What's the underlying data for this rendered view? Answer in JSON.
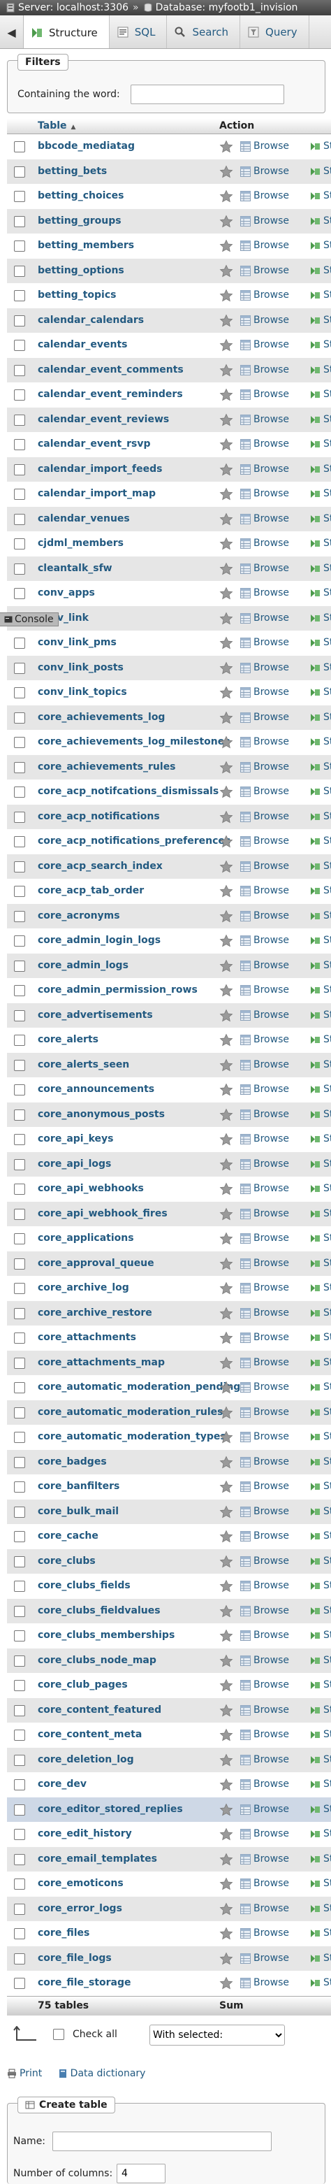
{
  "breadcrumb": {
    "server": "Server: localhost:3306",
    "separator": "»",
    "database": "Database: myfootb1_invision"
  },
  "tabs": [
    {
      "label": "Structure",
      "icon": "structure-icon",
      "active": true
    },
    {
      "label": "SQL",
      "icon": "sql-icon",
      "active": false
    },
    {
      "label": "Search",
      "icon": "search-icon",
      "active": false
    },
    {
      "label": "Query",
      "icon": "query-icon",
      "active": false
    }
  ],
  "filters": {
    "legend": "Filters",
    "label": "Containing the word:",
    "value": ""
  },
  "table": {
    "header_table": "Table",
    "header_action": "Action",
    "sort_indicator": "▲",
    "browse_label": "Browse",
    "structure_label": "Str",
    "rows": [
      "bbcode_mediatag",
      "betting_bets",
      "betting_choices",
      "betting_groups",
      "betting_members",
      "betting_options",
      "betting_topics",
      "calendar_calendars",
      "calendar_events",
      "calendar_event_comments",
      "calendar_event_reminders",
      "calendar_event_reviews",
      "calendar_event_rsvp",
      "calendar_import_feeds",
      "calendar_import_map",
      "calendar_venues",
      "cjdml_members",
      "cleantalk_sfw",
      "conv_apps",
      "conv_link",
      "conv_link_pms",
      "conv_link_posts",
      "conv_link_topics",
      "core_achievements_log",
      "core_achievements_log_milestones",
      "core_achievements_rules",
      "core_acp_notifcations_dismissals",
      "core_acp_notifications",
      "core_acp_notifications_preferences",
      "core_acp_search_index",
      "core_acp_tab_order",
      "core_acronyms",
      "core_admin_login_logs",
      "core_admin_logs",
      "core_admin_permission_rows",
      "core_advertisements",
      "core_alerts",
      "core_alerts_seen",
      "core_announcements",
      "core_anonymous_posts",
      "core_api_keys",
      "core_api_logs",
      "core_api_webhooks",
      "core_api_webhook_fires",
      "core_applications",
      "core_approval_queue",
      "core_archive_log",
      "core_archive_restore",
      "core_attachments",
      "core_attachments_map",
      "core_automatic_moderation_pending",
      "core_automatic_moderation_rules",
      "core_automatic_moderation_types",
      "core_badges",
      "core_banfilters",
      "core_bulk_mail",
      "core_cache",
      "core_clubs",
      "core_clubs_fields",
      "core_clubs_fieldvalues",
      "core_clubs_memberships",
      "core_clubs_node_map",
      "core_club_pages",
      "core_content_featured",
      "core_content_meta",
      "core_deletion_log",
      "core_dev",
      "core_editor_stored_replies",
      "core_edit_history",
      "core_email_templates",
      "core_emoticons",
      "core_error_logs",
      "core_files",
      "core_file_logs",
      "core_file_storage"
    ],
    "footer_count": "75 tables",
    "footer_sum": "Sum"
  },
  "console": {
    "label": "Console"
  },
  "bulk": {
    "check_all_label": "Check all",
    "with_selected": "With selected:"
  },
  "links": {
    "print": "Print",
    "data_dictionary": "Data dictionary"
  },
  "create_table": {
    "legend": "Create table",
    "name_label": "Name:",
    "name_value": "",
    "columns_label": "Number of columns:",
    "columns_value": "4"
  },
  "colors": {
    "link": "#235a81",
    "row_even": "#e6e6e6",
    "row_highlight": "#ced8e6",
    "topbar": "#4a4a4a"
  }
}
